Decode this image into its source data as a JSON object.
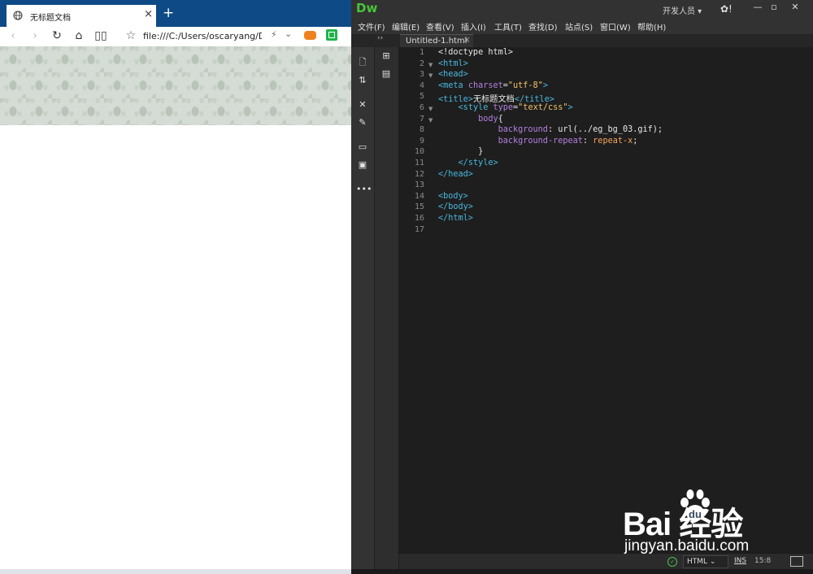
{
  "browser": {
    "tab_title": "无标题文档",
    "tab_close": "×",
    "new_tab": "+",
    "address": "file:///C:/Users/oscaryang/De",
    "nav": {
      "back": "‹",
      "forward": "›",
      "refresh": "↻",
      "home": "⌂",
      "reading": "▯▯",
      "favorite": "☆"
    }
  },
  "dw": {
    "logo": "Dw",
    "workspace": "开发人员 ▾",
    "gear": "✿!",
    "window_buttons": {
      "min": "—",
      "max": "▫",
      "close": "✕"
    },
    "menu": [
      "文件(F)",
      "编辑(E)",
      "查看(V)",
      "插入(I)",
      "工具(T)",
      "查找(D)",
      "站点(S)",
      "窗口(W)",
      "帮助(H)"
    ],
    "doc_tab": {
      "label": "Untitled-1.html",
      "close": "×"
    },
    "collapse": "››",
    "code_lines": [
      {
        "num": "1",
        "fold": "",
        "segs": [
          {
            "c": "plain",
            "t": "<!doctype html>"
          }
        ]
      },
      {
        "num": "2",
        "fold": "▼",
        "segs": [
          {
            "c": "tag",
            "t": "<html>"
          }
        ]
      },
      {
        "num": "3",
        "fold": "▼",
        "segs": [
          {
            "c": "tag",
            "t": "<head>"
          }
        ]
      },
      {
        "num": "4",
        "fold": "",
        "segs": [
          {
            "c": "tag",
            "t": "<meta "
          },
          {
            "c": "attr",
            "t": "charset"
          },
          {
            "c": "plain",
            "t": "="
          },
          {
            "c": "str",
            "t": "\"utf-8\""
          },
          {
            "c": "tag",
            "t": ">"
          }
        ]
      },
      {
        "num": "5",
        "fold": "",
        "segs": [
          {
            "c": "tag",
            "t": "<title>"
          },
          {
            "c": "plain",
            "t": "无标题文档"
          },
          {
            "c": "tag",
            "t": "</title>"
          }
        ]
      },
      {
        "num": "6",
        "fold": "▼",
        "segs": [
          {
            "c": "plain",
            "t": "    "
          },
          {
            "c": "tag",
            "t": "<style "
          },
          {
            "c": "attr",
            "t": "type"
          },
          {
            "c": "plain",
            "t": "="
          },
          {
            "c": "str",
            "t": "\"text/css\""
          },
          {
            "c": "tag",
            "t": ">"
          }
        ]
      },
      {
        "num": "7",
        "fold": "▼",
        "segs": [
          {
            "c": "plain",
            "t": "        "
          },
          {
            "c": "prop",
            "t": "body"
          },
          {
            "c": "plain",
            "t": "{"
          }
        ]
      },
      {
        "num": "8",
        "fold": "",
        "segs": [
          {
            "c": "plain",
            "t": "            "
          },
          {
            "c": "prop",
            "t": "background"
          },
          {
            "c": "plain",
            "t": ": url(../eg_bg_03.gif);"
          }
        ]
      },
      {
        "num": "9",
        "fold": "",
        "segs": [
          {
            "c": "plain",
            "t": "            "
          },
          {
            "c": "prop",
            "t": "background-repeat"
          },
          {
            "c": "plain",
            "t": ": "
          },
          {
            "c": "val",
            "t": "repeat-x"
          },
          {
            "c": "plain",
            "t": ";"
          }
        ]
      },
      {
        "num": "10",
        "fold": "",
        "segs": [
          {
            "c": "plain",
            "t": "        }"
          }
        ]
      },
      {
        "num": "11",
        "fold": "",
        "segs": [
          {
            "c": "plain",
            "t": "    "
          },
          {
            "c": "tag",
            "t": "</style>"
          }
        ]
      },
      {
        "num": "12",
        "fold": "",
        "segs": [
          {
            "c": "tag",
            "t": "</head>"
          }
        ]
      },
      {
        "num": "13",
        "fold": "",
        "segs": []
      },
      {
        "num": "14",
        "fold": "",
        "segs": [
          {
            "c": "tag",
            "t": "<body>"
          }
        ]
      },
      {
        "num": "15",
        "fold": "",
        "segs": [
          {
            "c": "tag",
            "t": "</body>"
          }
        ]
      },
      {
        "num": "16",
        "fold": "",
        "segs": [
          {
            "c": "tag",
            "t": "</html>"
          }
        ]
      },
      {
        "num": "17",
        "fold": "",
        "segs": []
      }
    ],
    "status": {
      "ok": "✓",
      "language": "HTML  ⌄",
      "mode": "INS",
      "position": "15:8"
    }
  },
  "watermark": {
    "logo": "Bai  经验",
    "url": "jingyan.baidu.com"
  },
  "colors": {
    "tabstrip": "#0e4a86",
    "dw_logo": "#48c43a",
    "tag": "#4ab7dd",
    "attr": "#b47fe0",
    "string": "#f0c26b",
    "value": "#f5a65b"
  }
}
